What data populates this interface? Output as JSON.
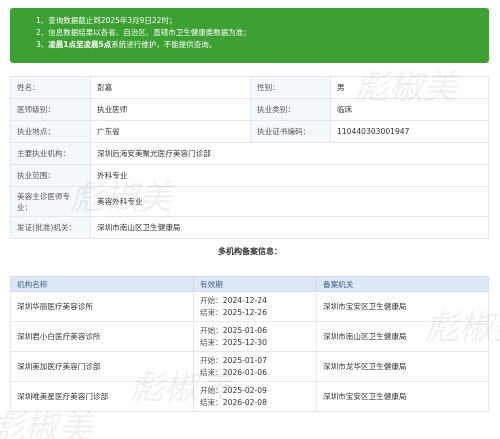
{
  "notice": {
    "line1": "1、查询数据截止到2025年3月9日22时；",
    "line2": "2、信息数据结果以各省、自治区、直辖市卫生健康委数据为准；",
    "line3_prefix": "3、",
    "line3_bold": "凌晨1点至凌晨5点",
    "line3_suffix": "系统进行维护，不能提供查询。"
  },
  "info": {
    "name_label": "姓名：",
    "name_value": "彭嘉",
    "gender_label": "性别：",
    "gender_value": "男",
    "level_label": "医师级别：",
    "level_value": "执业医师",
    "category_label": "执业类别：",
    "category_value": "临床",
    "location_label": "执业地点：",
    "location_value": "广东省",
    "cert_label": "执业证书编码：",
    "cert_value": "110440303001947",
    "org_label": "主要执业机构：",
    "org_value": "深圳后海安美聚光医疗美容门诊部",
    "scope_label": "执业范围：",
    "scope_value": "外科专业",
    "major_label": "美容主诊医师专业：",
    "major_value": "美容外科专业",
    "issuer_label": "发证(批准)机关：",
    "issuer_value": "深圳市南山区卫生健康局"
  },
  "multi": {
    "title": "多机构备案信息：",
    "headers": {
      "org": "机构名称",
      "valid": "有效期",
      "dept": "备案机关"
    },
    "start_label": "开始：",
    "end_label": "结束：",
    "rows": [
      {
        "org": "深圳华丽医疗美容诊所",
        "start": "2024-12-24",
        "end": "2025-12-26",
        "dept": "深圳市宝安区卫生健康局"
      },
      {
        "org": "深圳君小白医疗美容诊所",
        "start": "2025-01-06",
        "end": "2025-12-30",
        "dept": "深圳市南山区卫生健康局"
      },
      {
        "org": "深圳美加医疗美容门诊部",
        "start": "2025-01-07",
        "end": "2026-01-06",
        "dept": "深圳市龙华区卫生健康局"
      },
      {
        "org": "深圳唯美星医疗美容门诊部",
        "start": "2025-02-09",
        "end": "2026-02-08",
        "dept": "深圳市宝安区卫生健康局"
      }
    ]
  },
  "watermark": {
    "text": "彪椒美"
  }
}
